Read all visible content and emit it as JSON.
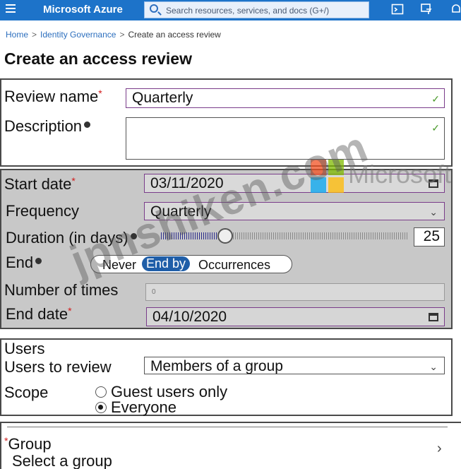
{
  "topbar": {
    "brand": "Microsoft Azure",
    "search_placeholder": "Search resources, services, and docs (G+/)",
    "icons": [
      "menu-icon",
      "search-icon",
      "cloud-shell-icon",
      "directory-filter-icon",
      "notifications-icon"
    ]
  },
  "breadcrumb": {
    "home": "Home",
    "parent": "Identity Governance",
    "current": "Create an access review"
  },
  "page_title": "Create an access review",
  "basics": {
    "review_name_label": "Review name",
    "review_name_value": "Quarterly",
    "description_label": "Description",
    "description_value": ""
  },
  "schedule": {
    "start_date_label": "Start date",
    "start_date_value": "03/11/2020",
    "frequency_label": "Frequency",
    "frequency_value": "Quarterly",
    "duration_label": "Duration (in days)",
    "duration_value": "25",
    "duration_fraction": 0.26,
    "end_label": "End",
    "end_options": [
      "Never",
      "End by",
      "Occurrences"
    ],
    "end_selected": "End by",
    "number_of_times_label": "Number of times",
    "number_of_times_value": "0",
    "end_date_label": "End date",
    "end_date_value": "04/10/2020"
  },
  "users": {
    "section_label": "Users",
    "users_to_review_label": "Users to review",
    "users_to_review_value": "Members of a group",
    "scope_label": "Scope",
    "scope_options": [
      "Guest users only",
      "Everyone"
    ],
    "scope_selected": "Everyone"
  },
  "group": {
    "label": "Group",
    "placeholder": "Select a group"
  },
  "watermark": {
    "text": "jpnshiken.com",
    "brand": "Microsoft"
  },
  "colors": {
    "topbar": "#1d73c9",
    "accent": "#1f5ea8",
    "field_border": "#7a3c8a",
    "required": "#d21b1b"
  }
}
